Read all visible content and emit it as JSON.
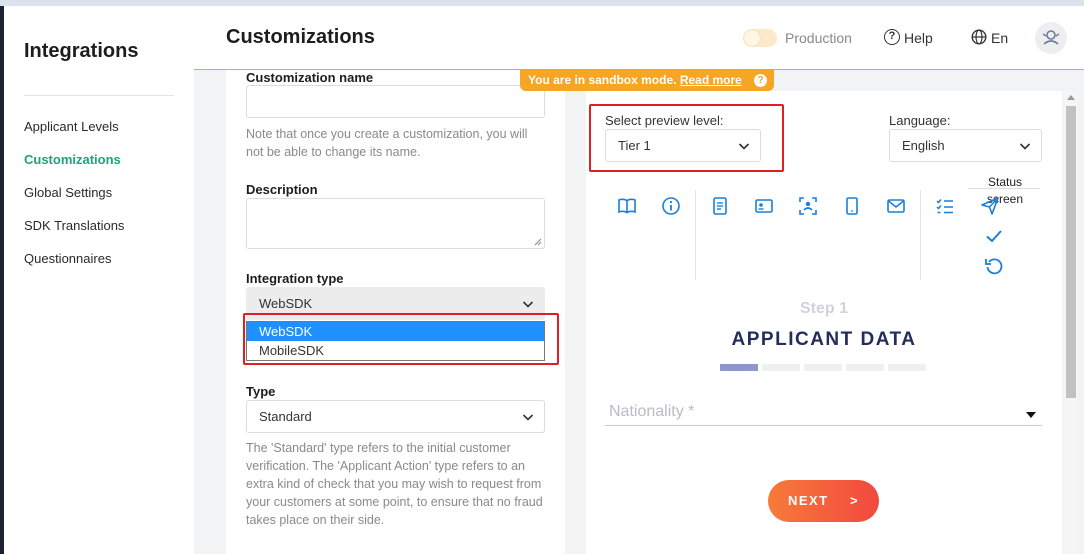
{
  "sidebar": {
    "title": "Integrations",
    "items": [
      {
        "label": "Applicant Levels"
      },
      {
        "label": "Customizations"
      },
      {
        "label": "Global Settings"
      },
      {
        "label": "SDK Translations"
      },
      {
        "label": "Questionnaires"
      }
    ],
    "active": "Customizations"
  },
  "header": {
    "title": "Customizations",
    "production_label": "Production",
    "help_label": "Help",
    "language_label": "En"
  },
  "banner": {
    "text": "You are in sandbox mode.",
    "link": "Read more",
    "help_glyph": "?"
  },
  "form": {
    "name_label": "Customization name",
    "name_value": "",
    "name_hint": "Note that once you create a customization, you will not be able to change its name.",
    "description_label": "Description",
    "description_value": "",
    "integration_type_label": "Integration type",
    "integration_type_value": "WebSDK",
    "integration_type_options": [
      "WebSDK",
      "MobileSDK"
    ],
    "type_label": "Type",
    "type_value": "Standard",
    "type_hint": "The 'Standard' type refers to the initial customer verification. The 'Applicant Action' type refers to an extra kind of check that you may wish to request from your customers at some point, to ensure that no fraud takes place on their side."
  },
  "preview": {
    "level_label": "Select preview level:",
    "level_value": "Tier 1",
    "language_label": "Language:",
    "language_value": "English",
    "status_screen_label": "Status screen",
    "step_label": "Step 1",
    "step_title": "APPLICANT DATA",
    "progress": {
      "current_step": 1,
      "total_steps": 5
    },
    "nationality_placeholder": "Nationality *",
    "next_label": "NEXT",
    "next_arrow": ">"
  },
  "colors": {
    "accent_green": "#1aa57a",
    "sandbox_orange": "#f6a623",
    "icon_blue": "#1a7fd8",
    "title_navy": "#232e5f",
    "next_gradient_start": "#f77b3a",
    "next_gradient_end": "#f2483f",
    "highlight_red": "#e02020"
  },
  "icons": {
    "row": [
      "book-icon",
      "info-icon",
      "document-icon",
      "id-card-icon",
      "face-scan-icon",
      "phone-icon",
      "email-icon",
      "checklist-icon",
      "send-icon",
      "check-icon",
      "refresh-icon"
    ]
  }
}
